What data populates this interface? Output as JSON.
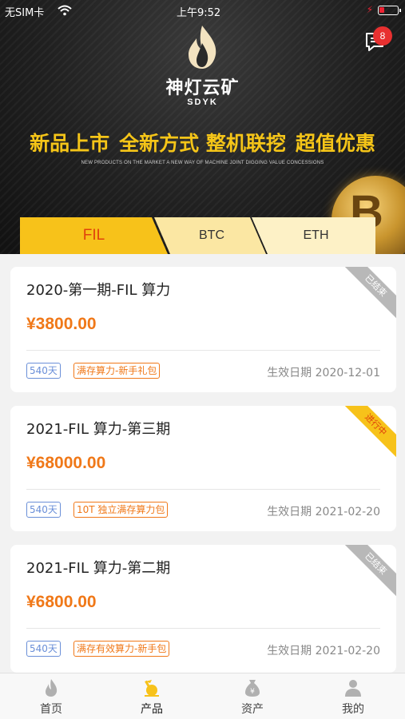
{
  "status_bar": {
    "carrier": "无SIM卡",
    "time": "上午9:52"
  },
  "header": {
    "brand_name": "神灯云矿",
    "brand_sub": "SDYK",
    "message_badge": "8",
    "slogan_parts": [
      "新品上市",
      "全新方式 整机联挖",
      "超值优惠"
    ],
    "slogan_sub": "NEW PRODUCTS ON THE MARKET A NEW WAY OF MACHINE JOINT DIGGING VALUE CONCESSIONS"
  },
  "tabs": [
    {
      "label": "FIL",
      "active": true
    },
    {
      "label": "BTC",
      "active": false
    },
    {
      "label": "ETH",
      "active": false
    }
  ],
  "products": [
    {
      "title": "2020-第一期-FIL 算力",
      "price": "¥3800.00",
      "days": "540天",
      "tag": "满存算力-新手礼包",
      "date": "生效日期 2020-12-01",
      "status": "已结束"
    },
    {
      "title": "2021-FIL 算力-第三期",
      "price": "¥68000.00",
      "days": "540天",
      "tag": "10T 独立满存算力包",
      "date": "生效日期 2021-02-20",
      "status": "进行中"
    },
    {
      "title": "2021-FIL 算力-第二期",
      "price": "¥6800.00",
      "days": "540天",
      "tag": "满存有效算力-新手包",
      "date": "生效日期 2021-02-20",
      "status": "已结束"
    }
  ],
  "bottom_nav": [
    {
      "label": "首页",
      "icon": "flame-icon"
    },
    {
      "label": "产品",
      "icon": "miner-icon",
      "active": true
    },
    {
      "label": "资产",
      "icon": "money-bag-icon"
    },
    {
      "label": "我的",
      "icon": "user-icon"
    }
  ],
  "colors": {
    "accent_yellow": "#f7c21a",
    "price_orange": "#f07818",
    "tag_blue": "#6a8fd8",
    "badge_red": "#e83030"
  }
}
